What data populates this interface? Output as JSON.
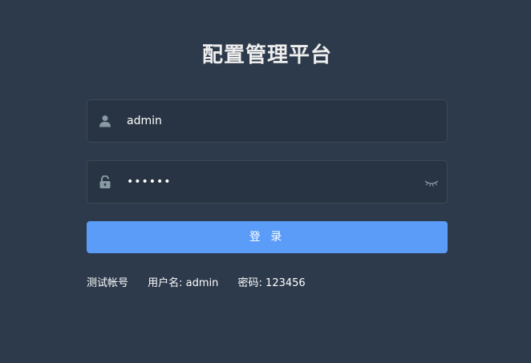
{
  "title": "配置管理平台",
  "username": {
    "value": "admin",
    "icon": "user-icon"
  },
  "password": {
    "value": "••••••",
    "icon": "lock-icon",
    "toggle_icon": "eye-closed-icon"
  },
  "login_button": {
    "label": "登 录"
  },
  "tips": {
    "label": "测试帐号",
    "username": "用户名: admin",
    "password": "密码: 123456"
  },
  "colors": {
    "background": "#2d3a4b",
    "button": "#5a9cf8",
    "title": "#eeeeee",
    "icon": "#889aa4"
  }
}
